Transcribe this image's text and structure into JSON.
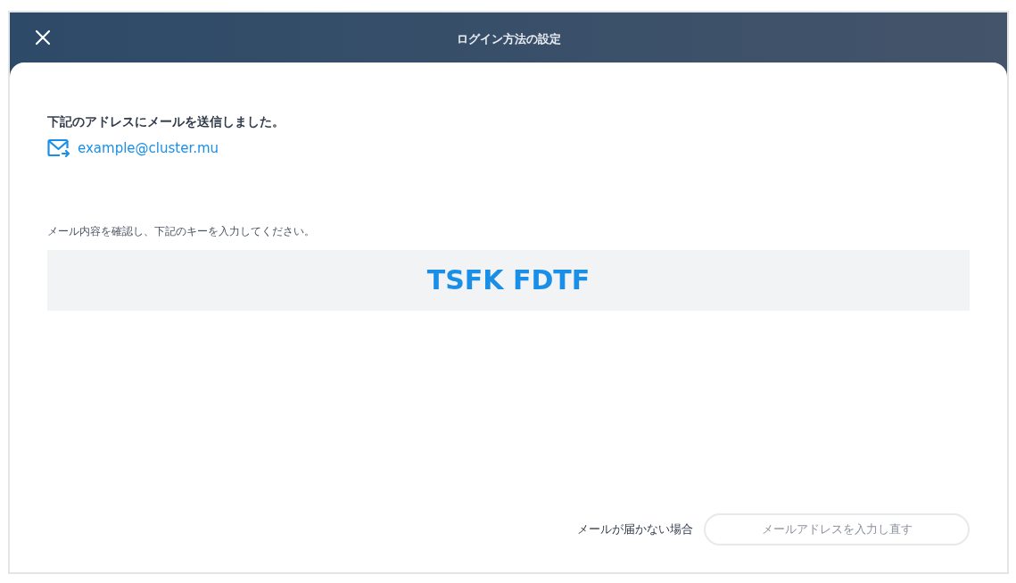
{
  "header": {
    "title": "ログイン方法の設定"
  },
  "message": "下記のアドレスにメールを送信しました。",
  "email": "example@cluster.mu",
  "instruction": "メール内容を確認し、下記のキーを入力してください。",
  "key": "TSFK FDTF",
  "footer": {
    "label": "メールが届かない場合",
    "button": "メールアドレスを入力し直す"
  }
}
